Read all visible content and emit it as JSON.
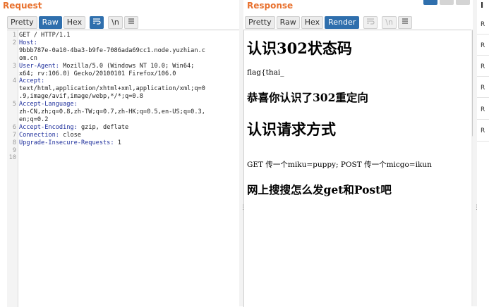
{
  "request": {
    "title": "Request",
    "buttons": {
      "pretty": "Pretty",
      "raw": "Raw",
      "hex": "Hex",
      "newline": "\\n"
    },
    "line_numbers": [
      "1",
      "2",
      "3",
      "4",
      "5",
      "6",
      "7",
      "8",
      "9",
      "10"
    ],
    "lines": [
      {
        "value": "GET / HTTP/1.1"
      },
      {
        "name": "Host:",
        "value": ""
      },
      {
        "value": "9bbb787e-0a10-4ba3-b9fe-7086ada69cc1.node.yuzhian.c"
      },
      {
        "value": "om.cn"
      },
      {
        "name": "User-Agent:",
        "value": " Mozilla/5.0 (Windows NT 10.0; Win64;"
      },
      {
        "value": "x64; rv:106.0) Gecko/20100101 Firefox/106.0"
      },
      {
        "name": "Accept:",
        "value": ""
      },
      {
        "value": "text/html,application/xhtml+xml,application/xml;q=0"
      },
      {
        "value": ".9,image/avif,image/webp,*/*;q=0.8"
      },
      {
        "name": "Accept-Language:",
        "value": ""
      },
      {
        "value": "zh-CN,zh;q=0.8,zh-TW;q=0.7,zh-HK;q=0.5,en-US;q=0.3,"
      },
      {
        "value": "en;q=0.2"
      },
      {
        "name": "Accept-Encoding:",
        "value": " gzip, deflate"
      },
      {
        "name": "Connection:",
        "value": " close"
      },
      {
        "name": "Upgrade-Insecure-Requests:",
        "value": " 1"
      }
    ]
  },
  "response": {
    "title": "Response",
    "buttons": {
      "pretty": "Pretty",
      "raw": "Raw",
      "hex": "Hex",
      "render": "Render",
      "newline": "\\n"
    },
    "render": {
      "h1_a": "认识302状态码",
      "p_flag": "flag{thai_",
      "h2_a": "恭喜你认识了302重定向",
      "h1_b": "认识请求方式",
      "p_methods": "GET 传一个miku=puppy; POST 传一个micgo=ikun",
      "h2_b": "网上搜搜怎么发get和Post吧"
    }
  },
  "inspector": {
    "title": "I",
    "items": [
      "R",
      "R",
      "R",
      "R",
      "R",
      "R"
    ]
  },
  "colors": {
    "accent": "#e8712e",
    "selected": "#2f6fad",
    "header_name": "#1e2f9c"
  }
}
